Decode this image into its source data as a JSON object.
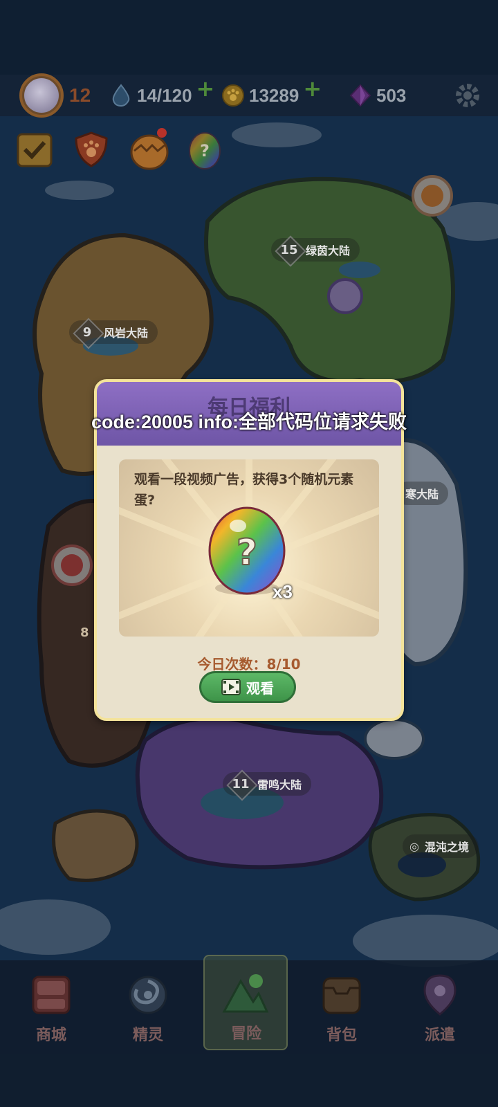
{
  "hud": {
    "level": "12",
    "energy": "14/120",
    "coins": "13289",
    "gems": "503"
  },
  "regions": [
    {
      "num": "15",
      "name": "绿茵大陆"
    },
    {
      "num": "9",
      "name": "风岩大陆"
    },
    {
      "num": "",
      "name": "寒大陆"
    },
    {
      "num": "8",
      "name": ""
    },
    {
      "num": "11",
      "name": "雷鸣大陆"
    },
    {
      "num": "",
      "name": "混沌之境"
    }
  ],
  "modal": {
    "title": "每日福利",
    "description": "观看一段视频广告，获得3个随机元素蛋?",
    "egg_count": "x3",
    "today_count": "今日次数：8/10",
    "watch_button": "观看"
  },
  "toast": "code:20005 info:全部代码位请求失败",
  "nav": {
    "tabs": [
      {
        "label": "商城"
      },
      {
        "label": "精灵"
      },
      {
        "label": "冒险"
      },
      {
        "label": "背包"
      },
      {
        "label": "派遣"
      }
    ]
  },
  "colors": {
    "ocean": "#1d4368",
    "modal_bg": "#e9e1cc",
    "modal_header": "#7b62b4",
    "button_green": "#4ea55a",
    "accent_orange": "#a65a2e"
  }
}
